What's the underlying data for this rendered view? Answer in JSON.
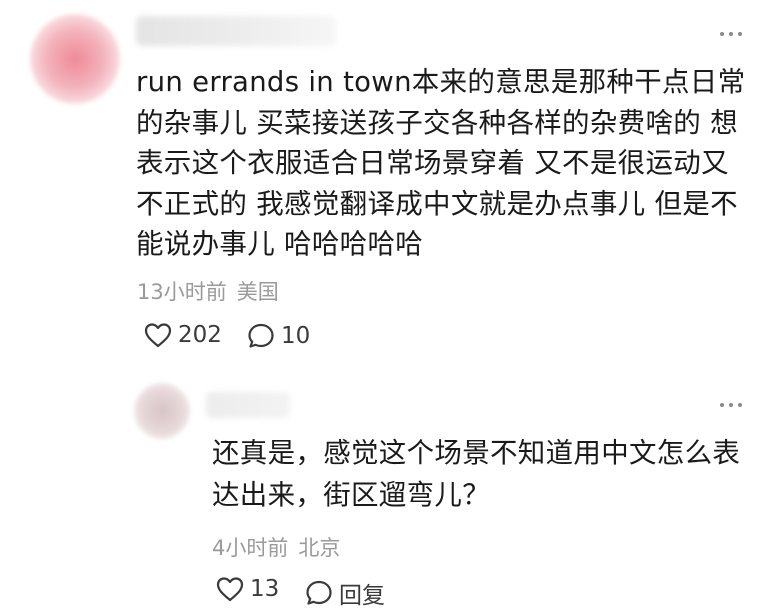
{
  "comment": {
    "text": "run errands in town本来的意思是那种干点日常的杂事儿 买菜接送孩子交各种各样的杂费啥的 想表示这个衣服适合日常场景穿着 又不是很运动又不正式的 我感觉翻译成中文就是办点事儿 但是不能说办事儿 哈哈哈哈哈",
    "time": "13小时前",
    "location": "美国",
    "likes": "202",
    "replies": "10",
    "like_icon": "heart-outline-icon",
    "reply_icon": "speech-bubble-icon",
    "more_icon": "more-dots-icon"
  },
  "reply": {
    "text": "还真是，感觉这个场景不知道用中文怎么表达出来，街区遛弯儿？",
    "time": "4小时前",
    "location": "北京",
    "likes": "13",
    "reply_label": "回复",
    "like_icon": "heart-outline-icon",
    "reply_icon": "speech-bubble-icon",
    "more_icon": "more-dots-icon"
  },
  "colors": {
    "text": "#1a1a1a",
    "meta": "#9a9a9a",
    "icon": "#3a3a3a",
    "background": "#ffffff"
  }
}
